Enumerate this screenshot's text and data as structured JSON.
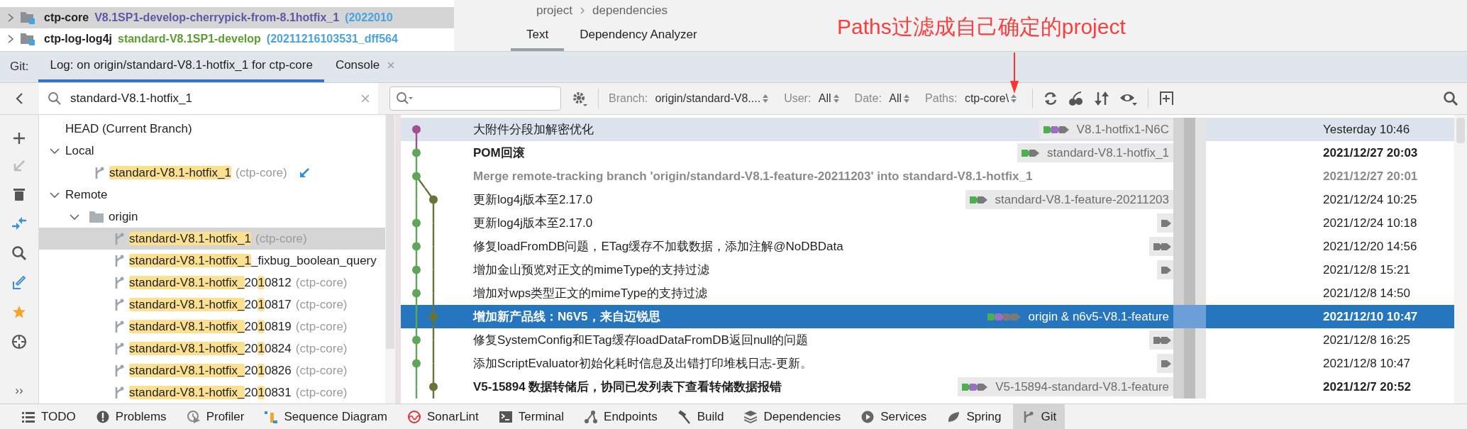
{
  "project_tree": [
    {
      "name": "ctp-core",
      "branch": "V8.1SP1-develop-cherrypick-from-8.1hotfix_1",
      "info": "(2022010",
      "color": "#5b59a6",
      "selected": true
    },
    {
      "name": "ctp-log-log4j",
      "branch": "standard-V8.1SP1-develop",
      "info": "(20211216103531_dff564",
      "color": "#5a9e2c",
      "selected": false
    }
  ],
  "breadcrumb": [
    "project",
    "dependencies"
  ],
  "editor_tabs": [
    {
      "label": "Text",
      "selected": true
    },
    {
      "label": "Dependency Analyzer",
      "selected": false
    }
  ],
  "annotation": {
    "text": "Paths过滤成自己确定的project"
  },
  "tool_window": {
    "label": "Git:",
    "tabs": [
      {
        "label": "Log: on origin/standard-V8.1-hotfix_1 for ctp-core",
        "selected": true,
        "closable": false
      },
      {
        "label": "Console",
        "selected": false,
        "closable": true
      }
    ]
  },
  "branch_search": {
    "value": "standard-V8.1-hotfix_1"
  },
  "branch_tree": [
    {
      "label": "HEAD (Current Branch)"
    },
    {
      "label": "Local",
      "expanded": true,
      "children": [
        {
          "kind": "branch",
          "segments": [
            {
              "text": "standard-V8.1-hotfix_1",
              "match": true
            }
          ],
          "repo": "(ctp-core)",
          "selected": false,
          "incoming": true
        }
      ]
    },
    {
      "label": "Remote",
      "expanded": true,
      "children": [
        {
          "kind": "folder",
          "label": "origin",
          "expanded": true,
          "children": [
            {
              "kind": "branch",
              "segments": [
                {
                  "text": "standard-V8.1-hotfix_1",
                  "match": true
                }
              ],
              "repo": "(ctp-core)",
              "selected": true,
              "incoming": false
            },
            {
              "kind": "branch",
              "segments": [
                {
                  "text": "standard-V8.1-hotfix_1",
                  "match": true
                },
                {
                  "text": "_fixbug_boolean_query",
                  "match": false
                }
              ],
              "selected": false,
              "incoming": false
            },
            {
              "kind": "branch",
              "segments": [
                {
                  "text": "standard-V8.1-hotfix_",
                  "match": true
                },
                {
                  "text": "20",
                  "match": false
                },
                {
                  "text": "1",
                  "match": true
                },
                {
                  "text": "0812",
                  "match": false
                }
              ],
              "repo": "(ctp-core)",
              "selected": false,
              "incoming": false
            },
            {
              "kind": "branch",
              "segments": [
                {
                  "text": "standard-V8.1-hotfix_",
                  "match": true
                },
                {
                  "text": "20",
                  "match": false
                },
                {
                  "text": "1",
                  "match": true
                },
                {
                  "text": "0817",
                  "match": false
                }
              ],
              "repo": "(ctp-core)",
              "selected": false,
              "incoming": false
            },
            {
              "kind": "branch",
              "segments": [
                {
                  "text": "standard-V8.1-hotfix_",
                  "match": true
                },
                {
                  "text": "20",
                  "match": false
                },
                {
                  "text": "1",
                  "match": true
                },
                {
                  "text": "0819",
                  "match": false
                }
              ],
              "repo": "(ctp-core)",
              "selected": false,
              "incoming": false
            },
            {
              "kind": "branch",
              "segments": [
                {
                  "text": "standard-V8.1-hotfix_",
                  "match": true
                },
                {
                  "text": "20",
                  "match": false
                },
                {
                  "text": "1",
                  "match": true
                },
                {
                  "text": "0824",
                  "match": false
                }
              ],
              "repo": "(ctp-core)",
              "selected": false,
              "incoming": false
            },
            {
              "kind": "branch",
              "segments": [
                {
                  "text": "standard-V8.1-hotfix_",
                  "match": true
                },
                {
                  "text": "20",
                  "match": false
                },
                {
                  "text": "1",
                  "match": true
                },
                {
                  "text": "0826",
                  "match": false
                }
              ],
              "repo": "(ctp-core)",
              "selected": false,
              "incoming": false
            },
            {
              "kind": "branch",
              "segments": [
                {
                  "text": "standard-V8.1-hotfix_",
                  "match": true
                },
                {
                  "text": "20",
                  "match": false
                },
                {
                  "text": "1",
                  "match": true
                },
                {
                  "text": "0831",
                  "match": false
                }
              ],
              "repo": "(ctp-core)",
              "selected": false,
              "incoming": false
            }
          ]
        }
      ]
    }
  ],
  "side_more": "››",
  "filters": [
    {
      "label": "Branch:",
      "value": "origin/standard-V8...."
    },
    {
      "label": "User:",
      "value": "All"
    },
    {
      "label": "Date:",
      "value": "All"
    },
    {
      "label": "Paths:",
      "value": "ctp-core\\"
    }
  ],
  "commits": [
    {
      "subject": "大附件分段加解密优化",
      "bold": false,
      "greyed": false,
      "current": true,
      "selected": false,
      "kind": "main",
      "color": "#a24f92",
      "ref": "V8.1-hotfix1-N6C",
      "tags": [
        {
          "color": "#4caf50"
        },
        {
          "color": "#9b6fc6"
        },
        {
          "color": "#7a7a7a"
        }
      ],
      "date": "Yesterday 10:46"
    },
    {
      "subject": "POM回滚",
      "bold": true,
      "greyed": false,
      "current": false,
      "selected": false,
      "kind": "main",
      "color": "#5fa65a",
      "ref": "standard-V8.1-hotfix_1",
      "tags": [
        {
          "color": "#4caf50"
        },
        {
          "color": "#7a7a7a"
        }
      ],
      "date": "2021/12/27 20:03"
    },
    {
      "subject": "Merge remote-tracking branch 'origin/standard-V8.1-feature-20211203' into standard-V8.1-hotfix_1",
      "bold": true,
      "greyed": true,
      "current": false,
      "selected": false,
      "kind": "main",
      "color": "#5fa65a",
      "date": "2021/12/27 20:01"
    },
    {
      "subject": "更新log4j版本至2.17.0",
      "bold": false,
      "greyed": false,
      "current": false,
      "selected": false,
      "kind": "side",
      "color": "#66743a",
      "ref": "standard-V8.1-feature-20211203",
      "tags": [
        {
          "color": "#4caf50"
        },
        {
          "color": "#7a7a7a"
        }
      ],
      "date": "2021/12/24 10:25"
    },
    {
      "subject": "更新log4j版本至2.17.0",
      "bold": false,
      "greyed": false,
      "current": false,
      "selected": false,
      "kind": "main",
      "color": "#5fa65a",
      "tags": [
        {
          "color": "#7a7a7a"
        }
      ],
      "date": "2021/12/24 10:18"
    },
    {
      "subject": "修复loadFromDB问题，ETag缓存不加载数据，添加注解@NoDBData",
      "bold": false,
      "greyed": false,
      "current": false,
      "selected": false,
      "kind": "main",
      "color": "#5fa65a",
      "tags": [
        {
          "color": "#7a7a7a"
        },
        {
          "color": "#7a7a7a"
        }
      ],
      "date": "2021/12/20 14:56"
    },
    {
      "subject": "增加金山预览对正文的mimeType的支持过滤",
      "bold": false,
      "greyed": false,
      "current": false,
      "selected": false,
      "kind": "main",
      "color": "#5fa65a",
      "tags": [
        {
          "color": "#7a7a7a"
        }
      ],
      "date": "2021/12/8 15:21"
    },
    {
      "subject": "增加对wps类型正文的mimeType的支持过滤",
      "bold": false,
      "greyed": false,
      "current": false,
      "selected": false,
      "kind": "main",
      "color": "#5fa65a",
      "date": "2021/12/8 14:50"
    },
    {
      "subject": "增加新产品线：N6V5，来自迈锐思",
      "bold": true,
      "greyed": false,
      "current": false,
      "selected": true,
      "kind": "side",
      "color": "#66743a",
      "ref": "origin & n6v5-V8.1-feature",
      "tags": [
        {
          "color": "#4caf50"
        },
        {
          "color": "#9b6fc6"
        },
        {
          "color": "#7a7a7a"
        },
        {
          "color": "#7a7a7a"
        }
      ],
      "date": "2021/12/10 10:47"
    },
    {
      "subject": "修复SystemConfig和ETag缓存loadDataFromDB返回null的问题",
      "bold": false,
      "greyed": false,
      "current": false,
      "selected": false,
      "kind": "main",
      "color": "#5fa65a",
      "tags": [
        {
          "color": "#7a7a7a"
        },
        {
          "color": "#7a7a7a"
        }
      ],
      "date": "2021/12/8 16:25"
    },
    {
      "subject": "添加ScriptEvaluator初始化耗时信息及出错打印堆栈日志-更新。",
      "bold": false,
      "greyed": false,
      "current": false,
      "selected": false,
      "kind": "main",
      "color": "#5fa65a",
      "tags": [
        {
          "color": "#7a7a7a"
        }
      ],
      "date": "2021/12/8 10:47"
    },
    {
      "subject": "V5-15894 数据转储后，协同已发列表下查看转储数据报错",
      "bold": true,
      "greyed": false,
      "current": false,
      "selected": false,
      "kind": "side",
      "color": "#66743a",
      "ref": "V5-15894-standard-V8.1-feature",
      "tags": [
        {
          "color": "#4caf50"
        },
        {
          "color": "#9b6fc6"
        },
        {
          "color": "#7a7a7a"
        }
      ],
      "date": "2021/12/7 20:52"
    }
  ],
  "tool_buttons": [
    {
      "label": "TODO",
      "selected": false
    },
    {
      "label": "Problems",
      "selected": false
    },
    {
      "label": "Profiler",
      "selected": false
    },
    {
      "label": "Sequence Diagram",
      "selected": false
    },
    {
      "label": "SonarLint",
      "selected": false
    },
    {
      "label": "Terminal",
      "selected": false
    },
    {
      "label": "Endpoints",
      "selected": false
    },
    {
      "label": "Build",
      "selected": false
    },
    {
      "label": "Dependencies",
      "selected": false
    },
    {
      "label": "Services",
      "selected": false
    },
    {
      "label": "Spring",
      "selected": false
    },
    {
      "label": "Git",
      "selected": true
    }
  ]
}
